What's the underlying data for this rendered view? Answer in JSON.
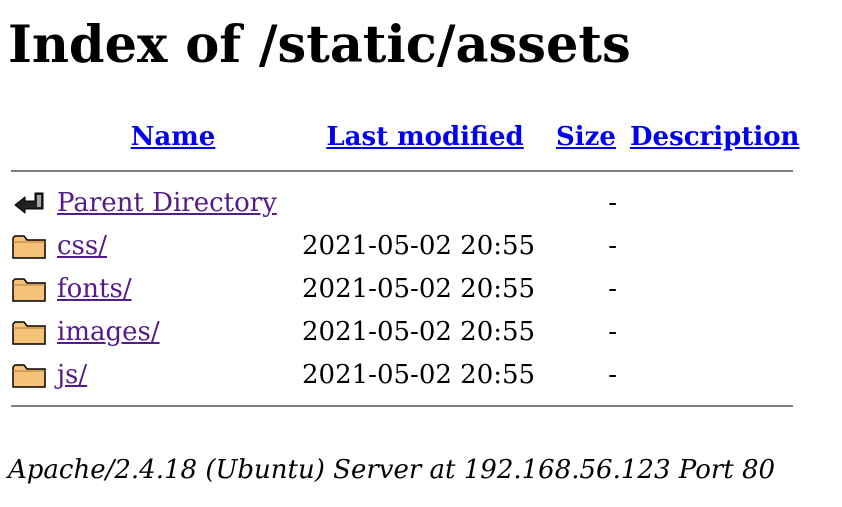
{
  "page": {
    "title": "Index of /static/assets"
  },
  "table": {
    "headers": {
      "name": "Name",
      "last_modified": "Last modified",
      "size": "Size",
      "description": "Description"
    },
    "rows": [
      {
        "icon": "back-icon",
        "name": "Parent Directory",
        "last_modified": "",
        "size": "-",
        "description": ""
      },
      {
        "icon": "folder-icon",
        "name": "css/",
        "last_modified": "2021-05-02 20:55",
        "size": "-",
        "description": ""
      },
      {
        "icon": "folder-icon",
        "name": "fonts/",
        "last_modified": "2021-05-02 20:55",
        "size": "-",
        "description": ""
      },
      {
        "icon": "folder-icon",
        "name": "images/",
        "last_modified": "2021-05-02 20:55",
        "size": "-",
        "description": ""
      },
      {
        "icon": "folder-icon",
        "name": "js/",
        "last_modified": "2021-05-02 20:55",
        "size": "-",
        "description": ""
      }
    ]
  },
  "footer": {
    "text": "Apache/2.4.18 (Ubuntu) Server at 192.168.56.123 Port 80"
  },
  "colors": {
    "link": "#0000ee",
    "visited_link": "#551a8b",
    "rule": "#808080",
    "folder": "#f6c27a"
  }
}
